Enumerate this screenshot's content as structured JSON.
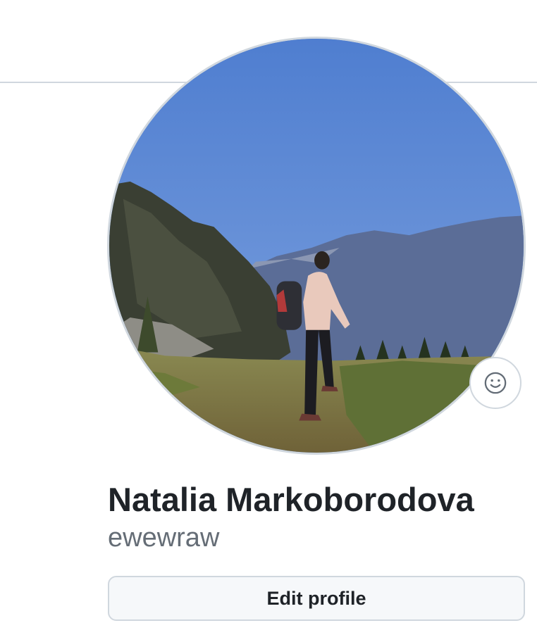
{
  "profile": {
    "full_name": "Natalia Markoborodova",
    "username": "ewewraw",
    "avatar_alt": "Profile photo of a hiker on a mountain ridge",
    "status_icon": "smiley-icon",
    "edit_label": "Edit profile"
  },
  "colors": {
    "text_primary": "#1f2328",
    "text_secondary": "#656d76",
    "border": "#d0d7de",
    "button_bg": "#f6f8fa"
  }
}
